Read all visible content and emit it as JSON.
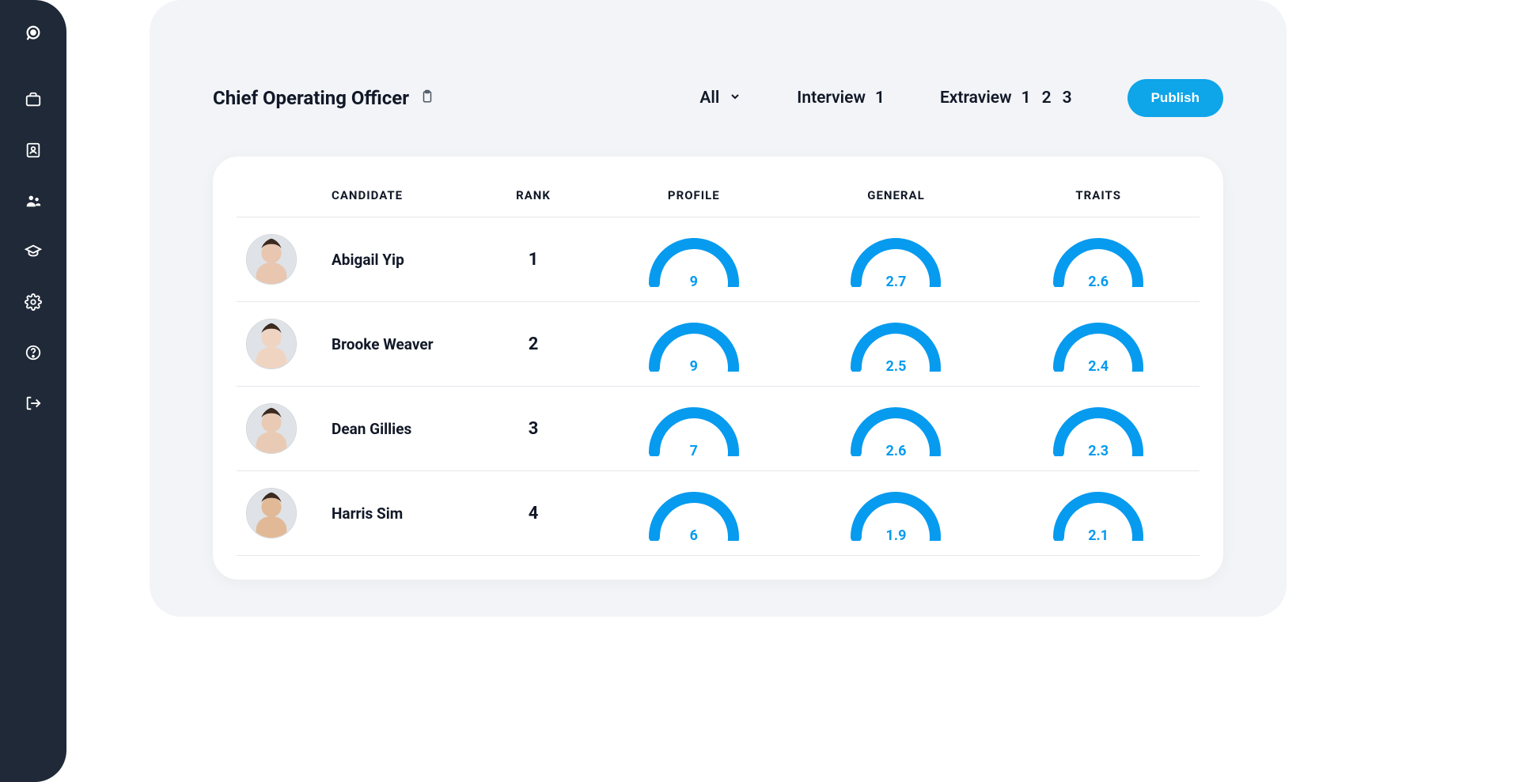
{
  "sidebar": {
    "items": [
      {
        "name": "logo-icon"
      },
      {
        "name": "briefcase-icon"
      },
      {
        "name": "id-badge-icon"
      },
      {
        "name": "people-icon"
      },
      {
        "name": "graduation-cap-icon"
      },
      {
        "name": "gear-icon"
      },
      {
        "name": "help-icon"
      },
      {
        "name": "logout-icon"
      }
    ]
  },
  "header": {
    "title": "Chief Operating Officer",
    "tabs": {
      "all_label": "All",
      "interview_label": "Interview",
      "interview_nums": [
        "1"
      ],
      "extraview_label": "Extraview",
      "extraview_nums": [
        "1",
        "2",
        "3"
      ]
    },
    "publish_label": "Publish"
  },
  "table": {
    "headers": {
      "candidate": "CANDIDATE",
      "rank": "RANK",
      "profile": "PROFILE",
      "general": "GENERAL",
      "traits": "TRAITS"
    },
    "rows": [
      {
        "name": "Abigail Yip",
        "rank": "1",
        "profile": 9,
        "profile_max": 10,
        "general": 2.7,
        "general_max": 3,
        "traits": 2.6,
        "traits_max": 3,
        "tone": "#e8c6b0"
      },
      {
        "name": "Brooke Weaver",
        "rank": "2",
        "profile": 9,
        "profile_max": 10,
        "general": 2.5,
        "general_max": 3,
        "traits": 2.4,
        "traits_max": 3,
        "tone": "#f0d4c2"
      },
      {
        "name": "Dean Gillies",
        "rank": "3",
        "profile": 7,
        "profile_max": 10,
        "general": 2.6,
        "general_max": 3,
        "traits": 2.3,
        "traits_max": 3,
        "tone": "#e9cbb5"
      },
      {
        "name": "Harris Sim",
        "rank": "4",
        "profile": 6,
        "profile_max": 10,
        "general": 1.9,
        "general_max": 3,
        "traits": 2.1,
        "traits_max": 3,
        "tone": "#e2b996"
      }
    ]
  },
  "colors": {
    "accent": "#069bef",
    "track": "#e5e7eb"
  }
}
